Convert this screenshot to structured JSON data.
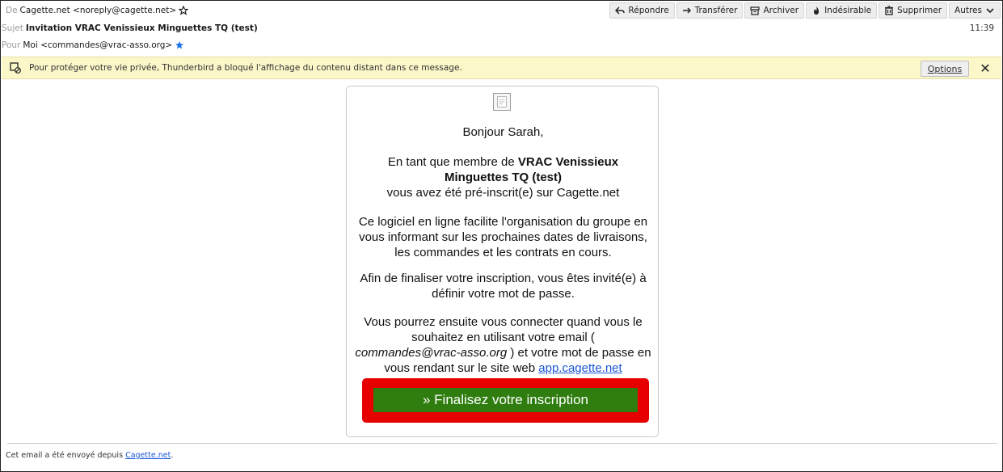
{
  "header": {
    "from_label": "De",
    "from_value": "Cagette.net <noreply@cagette.net>",
    "subject_label": "Sujet",
    "subject_value": "Invitation VRAC Venissieux Minguettes TQ (test)",
    "to_label": "Pour",
    "to_value": "Moi <commandes@vrac-asso.org>",
    "time": "11:39"
  },
  "toolbar": {
    "reply": "Répondre",
    "forward": "Transférer",
    "archive": "Archiver",
    "junk": "Indésirable",
    "delete": "Supprimer",
    "more": "Autres"
  },
  "notification": {
    "text": "Pour protéger votre vie privée, Thunderbird a bloqué l'affichage du contenu distant dans ce message.",
    "options_label": "Options",
    "close_label": "✕"
  },
  "email": {
    "greeting": "Bonjour Sarah,",
    "p2_pre": "En tant que membre de ",
    "p2_group": "VRAC Venissieux Minguettes TQ (test)",
    "p2_post": "vous avez été pré-inscrit(e) sur Cagette.net",
    "p3": "Ce logiciel en ligne facilite l'organisation du groupe en vous informant sur les prochaines dates de livraisons, les commandes et les contrats en cours.",
    "p4": "Afin de finaliser votre inscription, vous êtes invité(e) à définir votre mot de passe.",
    "p5_pre": "Vous pourrez ensuite vous connecter quand vous le souhaitez en utilisant votre email (",
    "p5_email": "commandes@vrac-asso.org",
    "p5_mid": ") et votre mot de passe en vous rendant sur le site web",
    "p5_link": "app.cagette.net",
    "cta": "» Finalisez votre inscription"
  },
  "footer": {
    "text": "Cet email a été envoyé depuis",
    "link": "Cagette.net",
    "end": "."
  }
}
